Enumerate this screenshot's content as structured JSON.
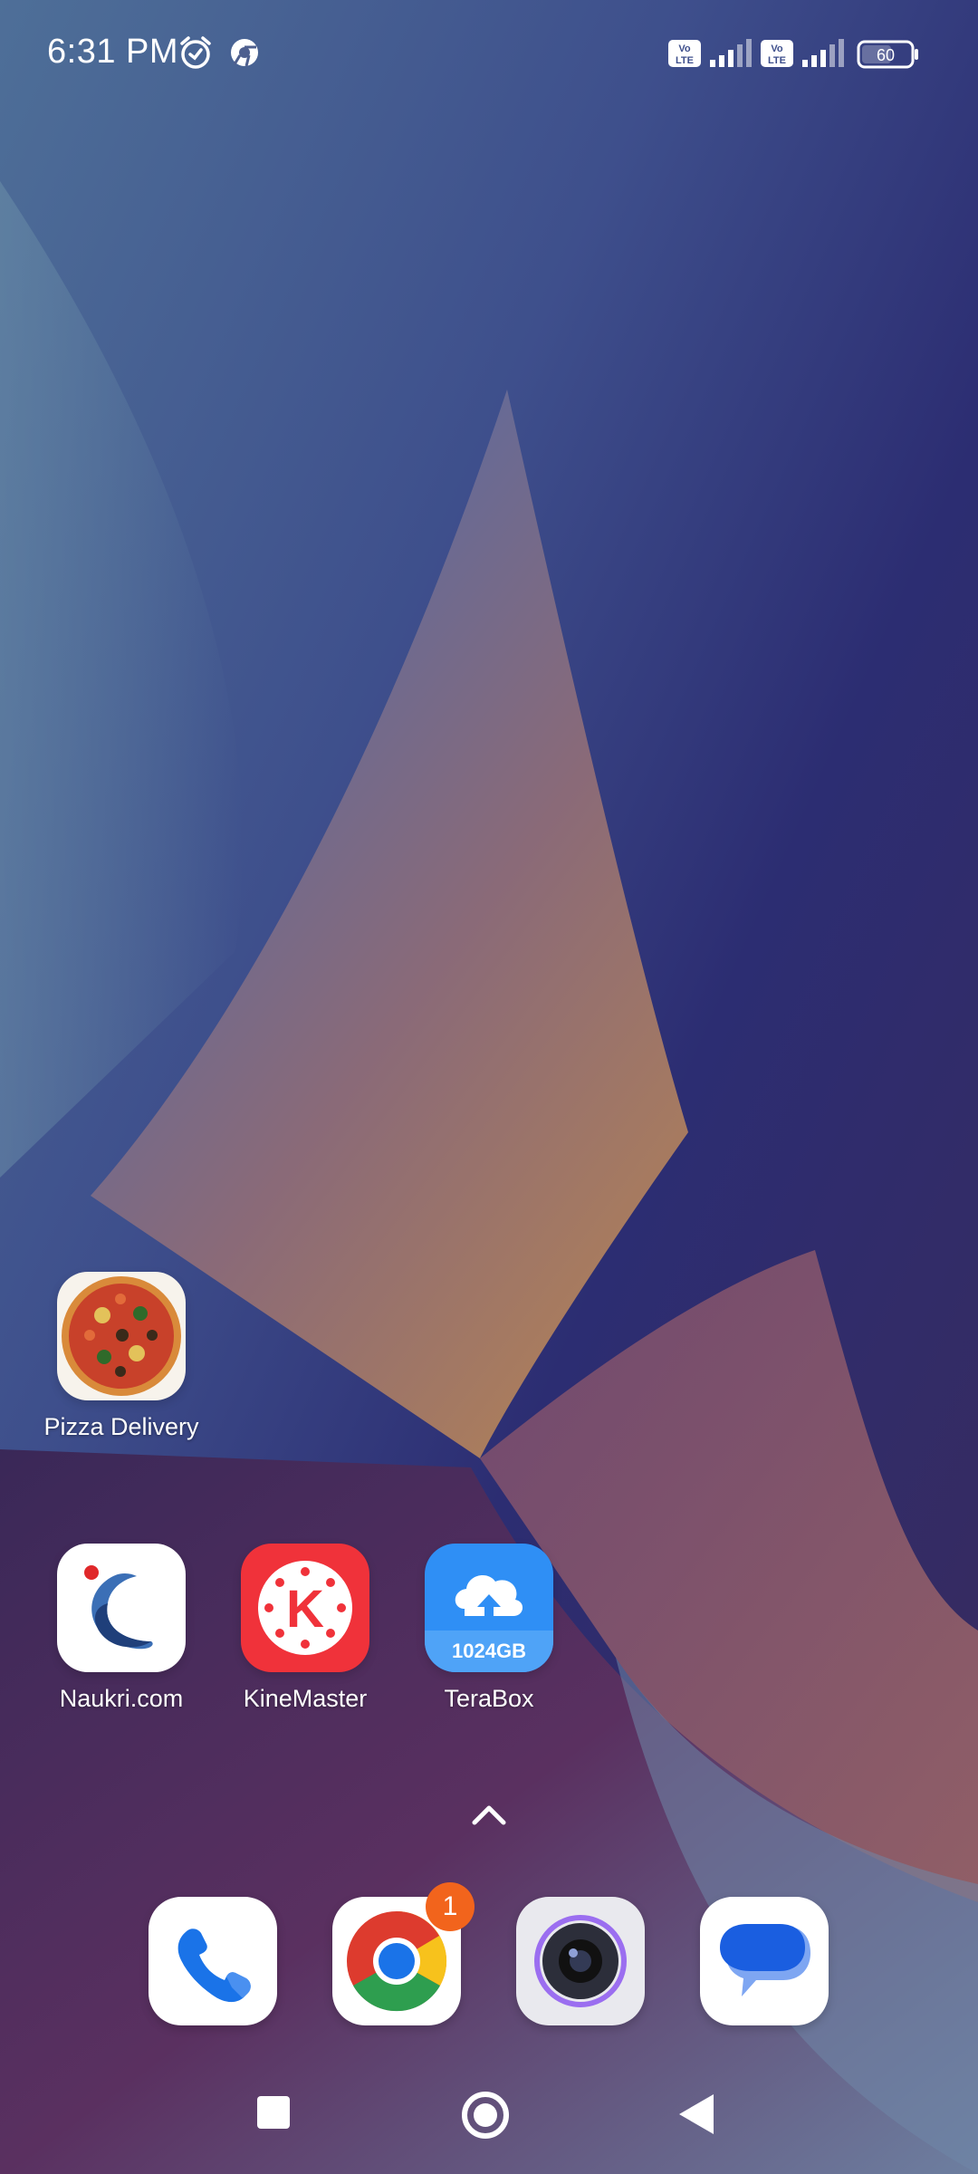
{
  "status_bar": {
    "time": "6:31 PM",
    "left_icons": [
      "alarm-icon",
      "chrome-notification-icon"
    ],
    "sim1_label": "Vo\nLTE",
    "sim2_label": "Vo\nLTE",
    "battery_level": "60"
  },
  "home_apps": [
    {
      "name": "Pizza Delivery",
      "icon": "pizza-icon"
    },
    {
      "name": "Naukri.com",
      "icon": "naukri-icon"
    },
    {
      "name": "KineMaster",
      "icon": "kinemaster-icon"
    },
    {
      "name": "TeraBox",
      "icon": "terabox-icon",
      "tile_text": "1024GB"
    }
  ],
  "dock": {
    "apps": [
      {
        "name": "Phone",
        "icon": "phone-icon"
      },
      {
        "name": "Chrome",
        "icon": "chrome-icon",
        "badge": "1"
      },
      {
        "name": "Camera",
        "icon": "camera-icon"
      },
      {
        "name": "Messages",
        "icon": "messages-icon"
      }
    ]
  },
  "nav": {
    "buttons": [
      "recents-button",
      "home-button",
      "back-button"
    ]
  },
  "colors": {
    "badge": "#f2641c",
    "kinemaster": "#f0323a",
    "terabox": "#2f8ff5"
  }
}
